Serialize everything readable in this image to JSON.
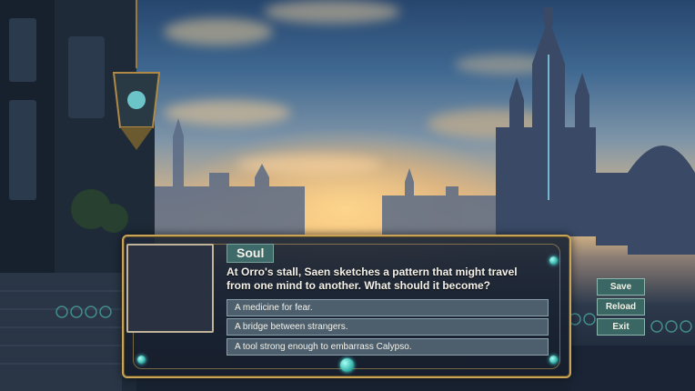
{
  "dialogue": {
    "speaker": "Soul",
    "text": "At Orro's stall, Saen sketches a pattern that might travel from one mind to another. What should it become?",
    "choices": [
      "A medicine for fear.",
      "A bridge between strangers.",
      "A tool strong enough to embarrass Calypso."
    ]
  },
  "menu": {
    "save": "Save",
    "reload": "Reload",
    "exit": "Exit"
  },
  "colors": {
    "frame_gold": "#c9a457",
    "button_teal": "#3a6764",
    "choice_slate": "#4d5f6d",
    "gem_cyan": "#38b8ae"
  },
  "icons": {
    "gem": "teal-gem-ornament"
  }
}
